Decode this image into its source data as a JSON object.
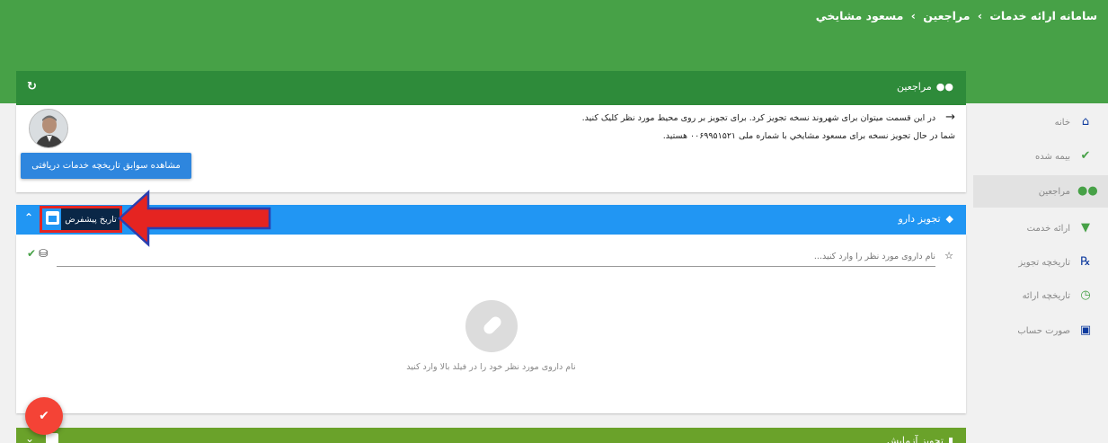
{
  "breadcrumb": {
    "items": [
      "سامانه ارائه خدمات",
      "مراجعین",
      "مسعود مشایخي"
    ],
    "separator": "›"
  },
  "sidebar": {
    "items": [
      {
        "label": "خانه",
        "icon": "home-icon",
        "active": false
      },
      {
        "label": "بیمه شده",
        "icon": "user-check-icon",
        "active": false
      },
      {
        "label": "مراجعین",
        "icon": "users-icon",
        "active": true
      },
      {
        "label": "ارائه خدمت",
        "icon": "basket-icon",
        "active": false
      },
      {
        "label": "تاریخچه تجویز",
        "icon": "rx-icon",
        "active": false
      },
      {
        "label": "تاریخچه ارائه",
        "icon": "history-icon",
        "active": false
      },
      {
        "label": "صورت حساب",
        "icon": "bill-icon",
        "active": false
      }
    ]
  },
  "patients_card": {
    "title": "مراجعین",
    "refresh_icon": "refresh-icon",
    "info_line1": "در این قسمت میتوان برای شهروند نسخه تجویز کرد. برای تجویز بر روی محیط مورد نظر کلیک کنید.",
    "info_line2": "شما در حال تجویز نسخه برای مسعود مشایخي با شماره ملی ۰۰۶۹۹۵۱۵۲۱ هستید.",
    "history_button": "مشاهده سوابق تاریخچه خدمات دریافتی"
  },
  "drug_card": {
    "title": "تجویز دارو",
    "tooltip": "تاریخ پیشفرض",
    "search_placeholder": "نام داروی مورد نظر را وارد کنید...",
    "empty_message": "نام داروی مورد نظر خود را در فیلد بالا وارد کنید"
  },
  "test_card": {
    "title": "تجویز آزمایش"
  },
  "colors": {
    "header_green": "#47a147",
    "card_green": "#2e8b3a",
    "drug_blue": "#2196f3",
    "annotation_red": "#e52421",
    "fab_red": "#f44336"
  }
}
